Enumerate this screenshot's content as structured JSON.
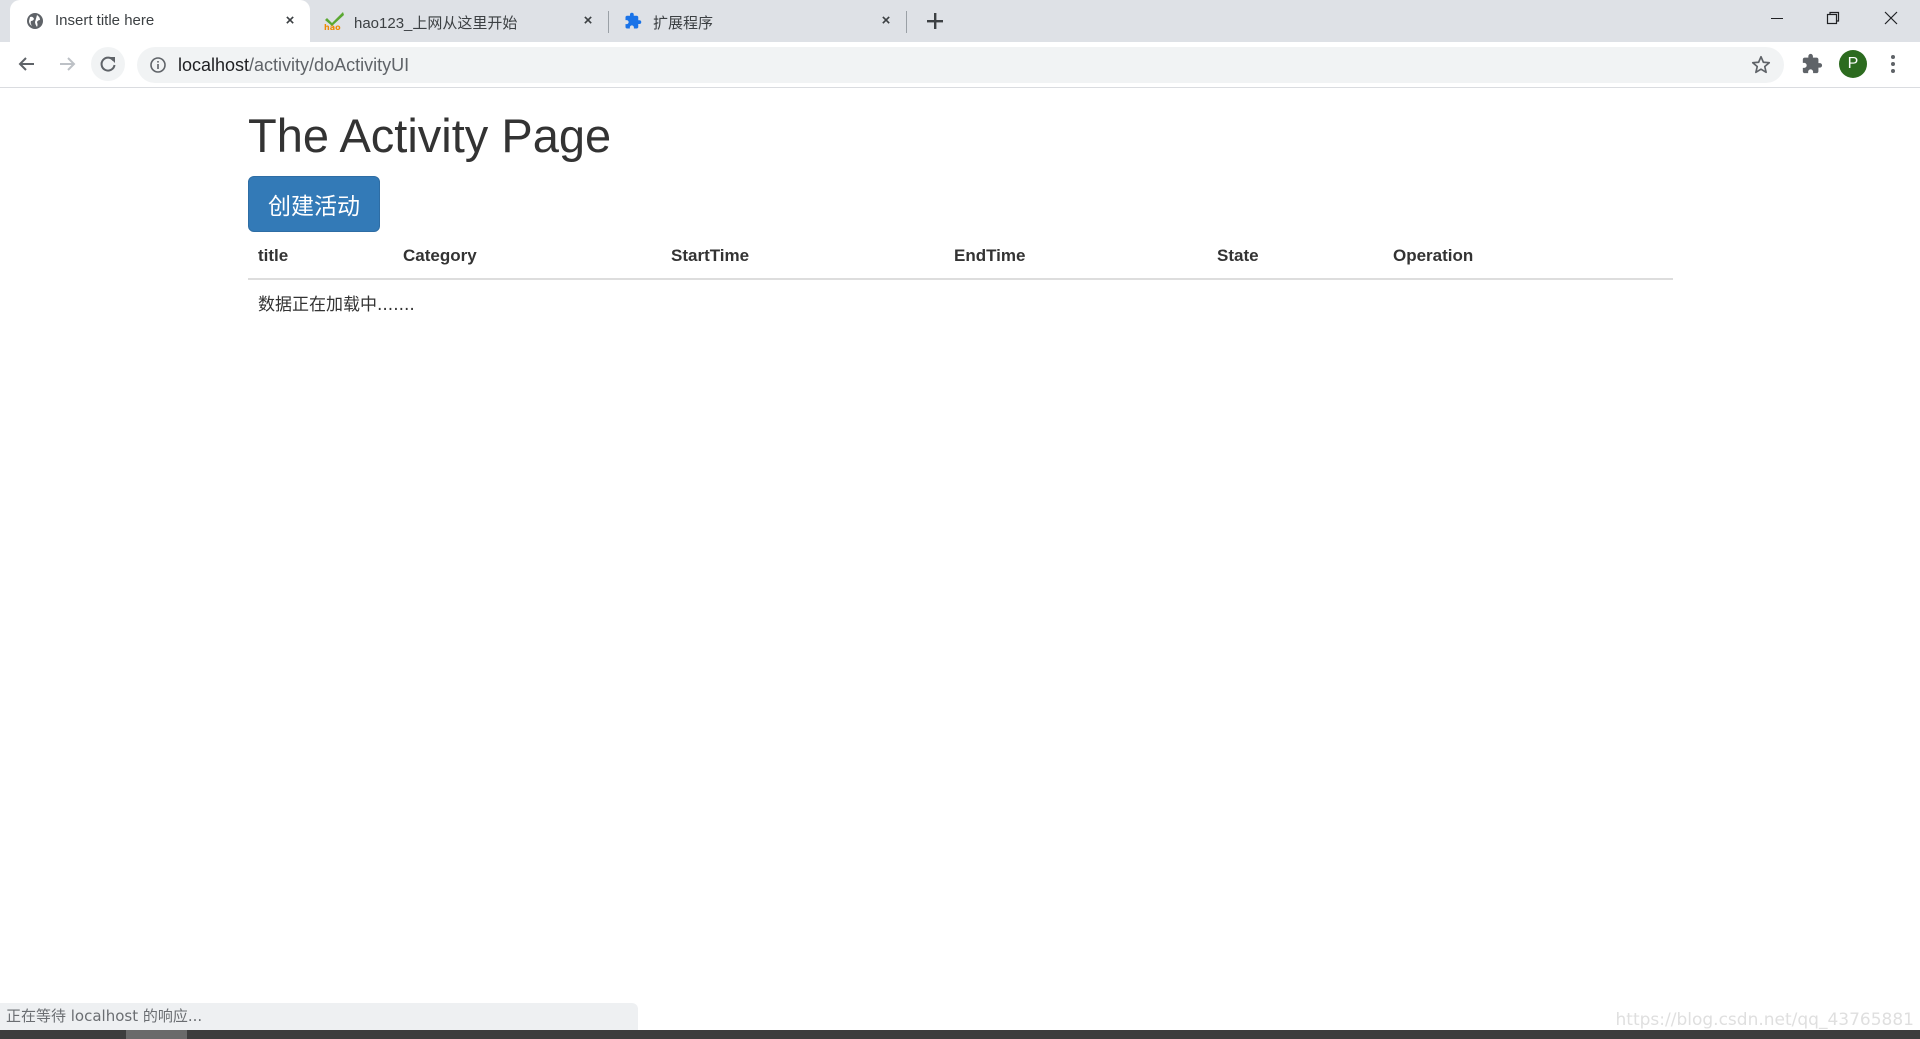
{
  "browser": {
    "tabs": [
      {
        "title": "Insert title here",
        "icon": "globe-icon",
        "active": true
      },
      {
        "title": "hao123_上网从这里开始",
        "icon": "hao123-logo-icon",
        "active": false
      },
      {
        "title": "扩展程序",
        "icon": "puzzle-icon",
        "active": false
      }
    ],
    "new_tab_symbol": "+",
    "close_symbol": "×",
    "address": {
      "host": "localhost",
      "path": "/activity/doActivityUI"
    },
    "profile_initial": "P",
    "colors": {
      "tabstrip": "#dee1e6",
      "avatar": "#2c6b1f",
      "extension_icon": "#1a73e8"
    }
  },
  "page": {
    "title": "The Activity Page",
    "create_button": "创建活动",
    "table": {
      "columns": [
        "title",
        "Category",
        "StartTime",
        "EndTime",
        "State",
        "Operation"
      ],
      "loading_message": "数据正在加载中......."
    },
    "colors": {
      "primary_button": "#337ab7",
      "text": "#333333",
      "table_border": "#dddddd"
    }
  },
  "status_bar": {
    "text": "正在等待 localhost 的响应..."
  },
  "watermark": "https://blog.csdn.net/qq_43765881"
}
